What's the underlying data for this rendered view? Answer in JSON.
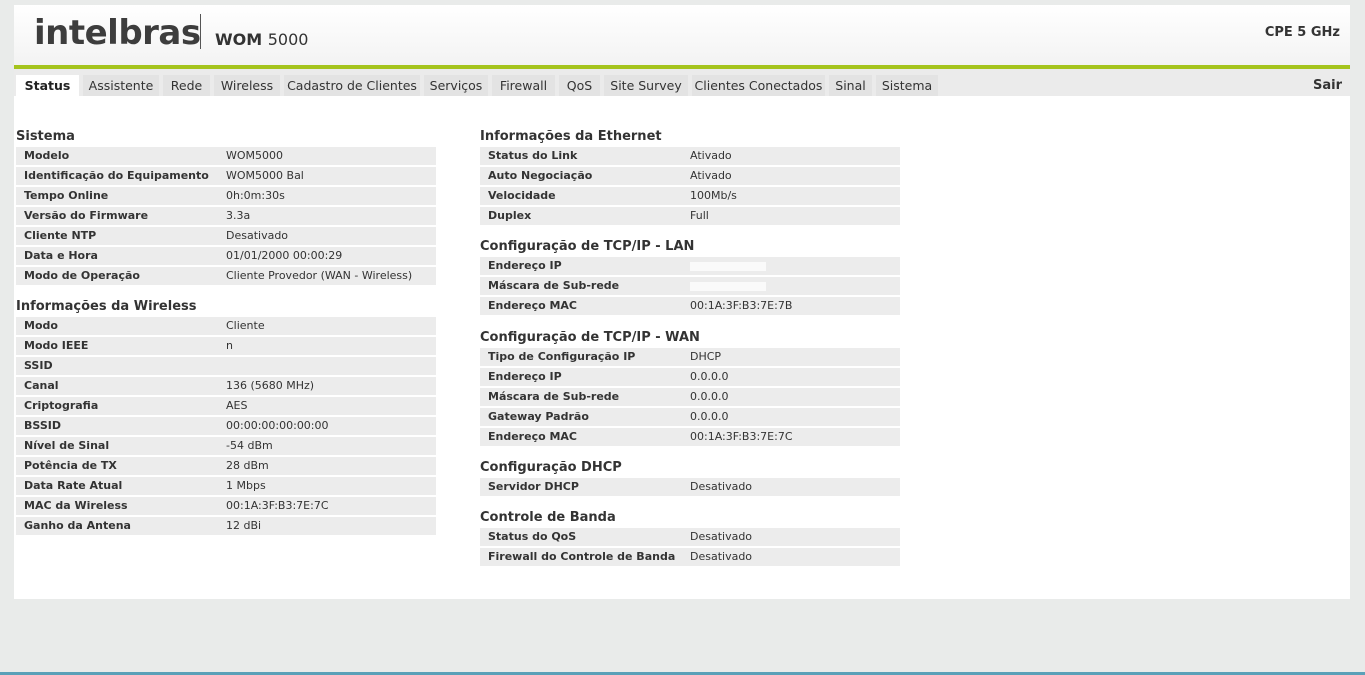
{
  "header": {
    "logo": "intelbras",
    "model_prefix": "WOM",
    "model_number": "5000",
    "product": "CPE 5 GHz"
  },
  "tabs": [
    {
      "label": "Status",
      "active": true
    },
    {
      "label": "Assistente"
    },
    {
      "label": "Rede"
    },
    {
      "label": "Wireless"
    },
    {
      "label": "Cadastro de Clientes"
    },
    {
      "label": "Serviços"
    },
    {
      "label": "Firewall"
    },
    {
      "label": "QoS"
    },
    {
      "label": "Site Survey"
    },
    {
      "label": "Clientes Conectados"
    },
    {
      "label": "Sinal"
    },
    {
      "label": "Sistema"
    }
  ],
  "logout": "Sair",
  "sistema": {
    "title": "Sistema",
    "rows": [
      {
        "k": "Modelo",
        "v": "WOM5000"
      },
      {
        "k": "Identificação do Equipamento",
        "v": "WOM5000 Bal"
      },
      {
        "k": "Tempo Online",
        "v": "0h:0m:30s"
      },
      {
        "k": "Versão do Firmware",
        "v": "3.3a"
      },
      {
        "k": "Cliente NTP",
        "v": "Desativado"
      },
      {
        "k": "Data e Hora",
        "v": "01/01/2000 00:00:29"
      },
      {
        "k": "Modo de Operação",
        "v": "Cliente Provedor (WAN - Wireless)"
      }
    ]
  },
  "wireless": {
    "title": "Informações da Wireless",
    "rows": [
      {
        "k": "Modo",
        "v": "Cliente"
      },
      {
        "k": "Modo IEEE",
        "v": "n"
      },
      {
        "k": "SSID",
        "v": ""
      },
      {
        "k": "Canal",
        "v": "136 (5680 MHz)"
      },
      {
        "k": "Criptografia",
        "v": "AES"
      },
      {
        "k": "BSSID",
        "v": "00:00:00:00:00:00"
      },
      {
        "k": "Nível de Sinal",
        "v": "-54 dBm"
      },
      {
        "k": "Potência de TX",
        "v": "28 dBm"
      },
      {
        "k": "Data Rate Atual",
        "v": "1 Mbps"
      },
      {
        "k": "MAC da Wireless",
        "v": "00:1A:3F:B3:7E:7C"
      },
      {
        "k": "Ganho da Antena",
        "v": "12 dBi"
      }
    ]
  },
  "ethernet": {
    "title": "Informações da Ethernet",
    "rows": [
      {
        "k": "Status do Link",
        "v": "Ativado"
      },
      {
        "k": "Auto Negociação",
        "v": "Ativado"
      },
      {
        "k": "Velocidade",
        "v": "100Mb/s"
      },
      {
        "k": "Duplex",
        "v": "Full"
      }
    ]
  },
  "lan": {
    "title": "Configuração de TCP/IP - LAN",
    "rows": [
      {
        "k": "Endereço IP",
        "v": ""
      },
      {
        "k": "Máscara de Sub-rede",
        "v": ""
      },
      {
        "k": "Endereço MAC",
        "v": "00:1A:3F:B3:7E:7B"
      }
    ]
  },
  "wan": {
    "title": "Configuração de TCP/IP - WAN",
    "rows": [
      {
        "k": "Tipo de Configuração IP",
        "v": "DHCP"
      },
      {
        "k": "Endereço IP",
        "v": "0.0.0.0"
      },
      {
        "k": "Máscara de Sub-rede",
        "v": "0.0.0.0"
      },
      {
        "k": "Gateway Padrão",
        "v": "0.0.0.0"
      },
      {
        "k": "Endereço MAC",
        "v": "00:1A:3F:B3:7E:7C"
      }
    ]
  },
  "dhcp": {
    "title": "Configuração DHCP",
    "rows": [
      {
        "k": "Servidor DHCP",
        "v": "Desativado"
      }
    ]
  },
  "banda": {
    "title": "Controle de Banda",
    "rows": [
      {
        "k": "Status do QoS",
        "v": "Desativado"
      },
      {
        "k": "Firewall do Controle de Banda",
        "v": "Desativado"
      }
    ]
  },
  "colors": {
    "accent": "#a5c41d",
    "row_bg": "#ececec",
    "page_bg": "#e9ebea"
  }
}
